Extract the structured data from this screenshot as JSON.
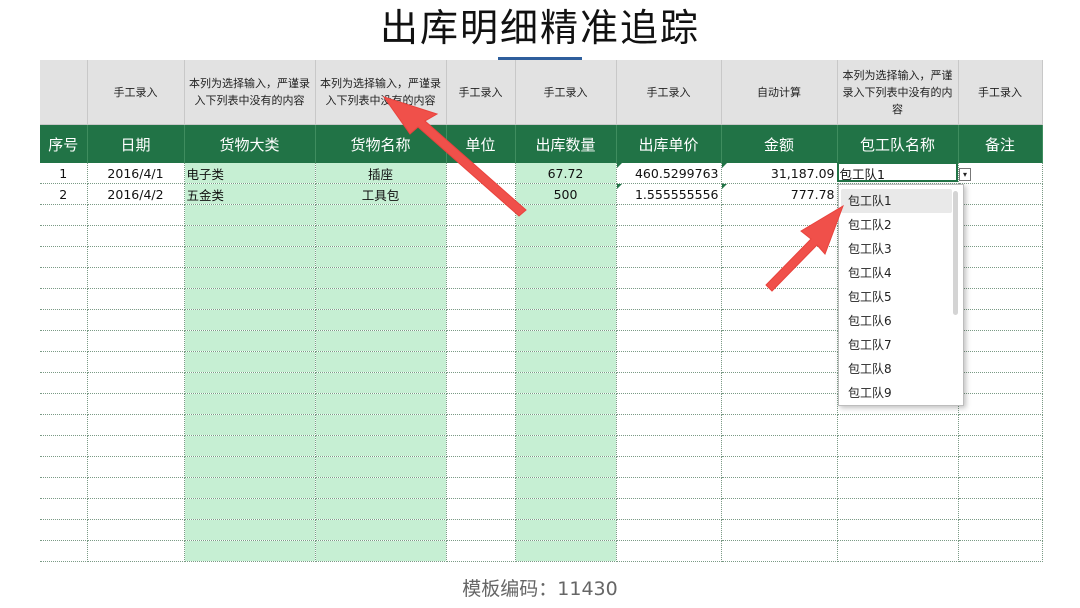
{
  "title": "出库明细精准追踪",
  "footer": "模板编码：11430",
  "note_row": [
    "",
    "手工录入",
    "本列为选择输入，严谨录入下列表中没有的内容",
    "本列为选择输入，严谨录入下列表中没有的内容",
    "手工录入",
    "手工录入",
    "手工录入",
    "自动计算",
    "本列为选择输入，严谨录入下列表中没有的内容",
    "手工录入"
  ],
  "headers": [
    "序号",
    "日期",
    "货物大类",
    "货物名称",
    "单位",
    "出库数量",
    "出库单价",
    "金额",
    "包工队名称",
    "备注"
  ],
  "rows": [
    [
      "1",
      "2016/4/1",
      "电子类",
      "插座",
      "",
      "67.72",
      "460.5299763",
      "31,187.09",
      "包工队1",
      ""
    ],
    [
      "2",
      "2016/4/2",
      "五金类",
      "工具包",
      "",
      "500",
      "1.555555556",
      "777.78",
      "",
      ""
    ]
  ],
  "dropdown": {
    "button_glyph": "▾",
    "options": [
      "包工队1",
      "包工队2",
      "包工队3",
      "包工队4",
      "包工队5",
      "包工队6",
      "包工队7",
      "包工队8",
      "包工队9"
    ],
    "selected_index": 0
  },
  "colors": {
    "header_green": "#217346",
    "column_fill": "#c6efd3",
    "arrow_red": "#f0504a",
    "note_gray": "#e2e2e2"
  }
}
